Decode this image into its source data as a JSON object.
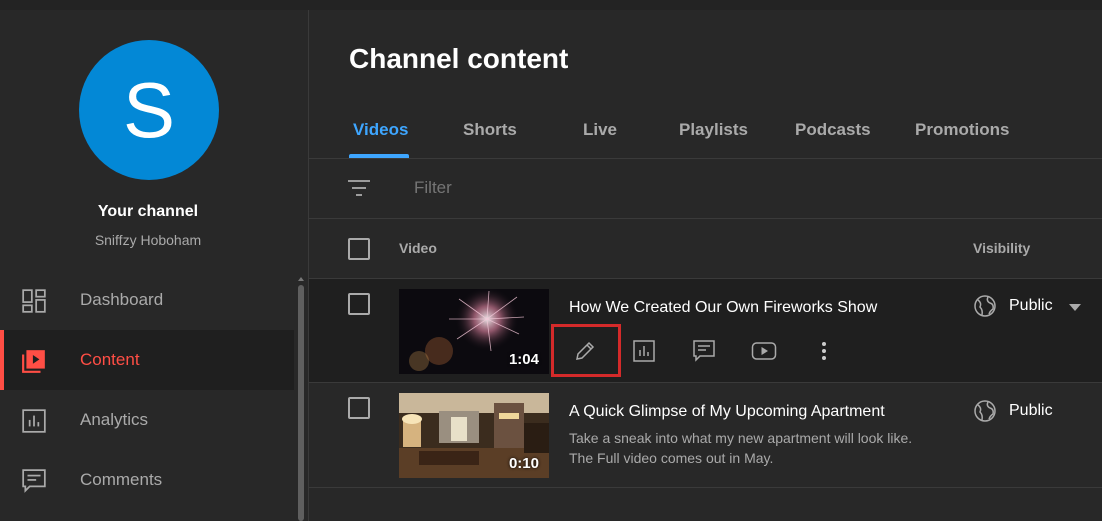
{
  "sidebar": {
    "avatar_letter": "S",
    "your_channel": "Your channel",
    "channel_name": "Sniffzy Hoboham",
    "items": [
      {
        "label": "Dashboard",
        "icon": "dashboard-icon"
      },
      {
        "label": "Content",
        "icon": "content-icon",
        "active": true
      },
      {
        "label": "Analytics",
        "icon": "analytics-icon"
      },
      {
        "label": "Comments",
        "icon": "comments-icon"
      }
    ]
  },
  "main": {
    "title": "Channel content",
    "tabs": [
      "Videos",
      "Shorts",
      "Live",
      "Playlists",
      "Podcasts",
      "Promotions"
    ],
    "active_tab": "Videos",
    "filter_placeholder": "Filter",
    "columns": {
      "video": "Video",
      "visibility": "Visibility"
    },
    "videos": [
      {
        "title": "How We Created Our Own Fireworks Show",
        "duration": "1:04",
        "description": "",
        "visibility": "Public",
        "actions": [
          "pencil-icon",
          "analytics-icon",
          "comments-icon",
          "youtube-icon",
          "more-vert-icon"
        ]
      },
      {
        "title": "A Quick Glimpse of My Upcoming Apartment",
        "duration": "0:10",
        "description": "Take a sneak into what my new apartment will look like. The Full video comes out in May.",
        "visibility": "Public"
      }
    ]
  },
  "colors": {
    "background": "#282828",
    "active_nav": "#ff4e45",
    "active_tab": "#3ea6ff",
    "avatar": "#0388d6",
    "highlight": "#d42a2a"
  }
}
